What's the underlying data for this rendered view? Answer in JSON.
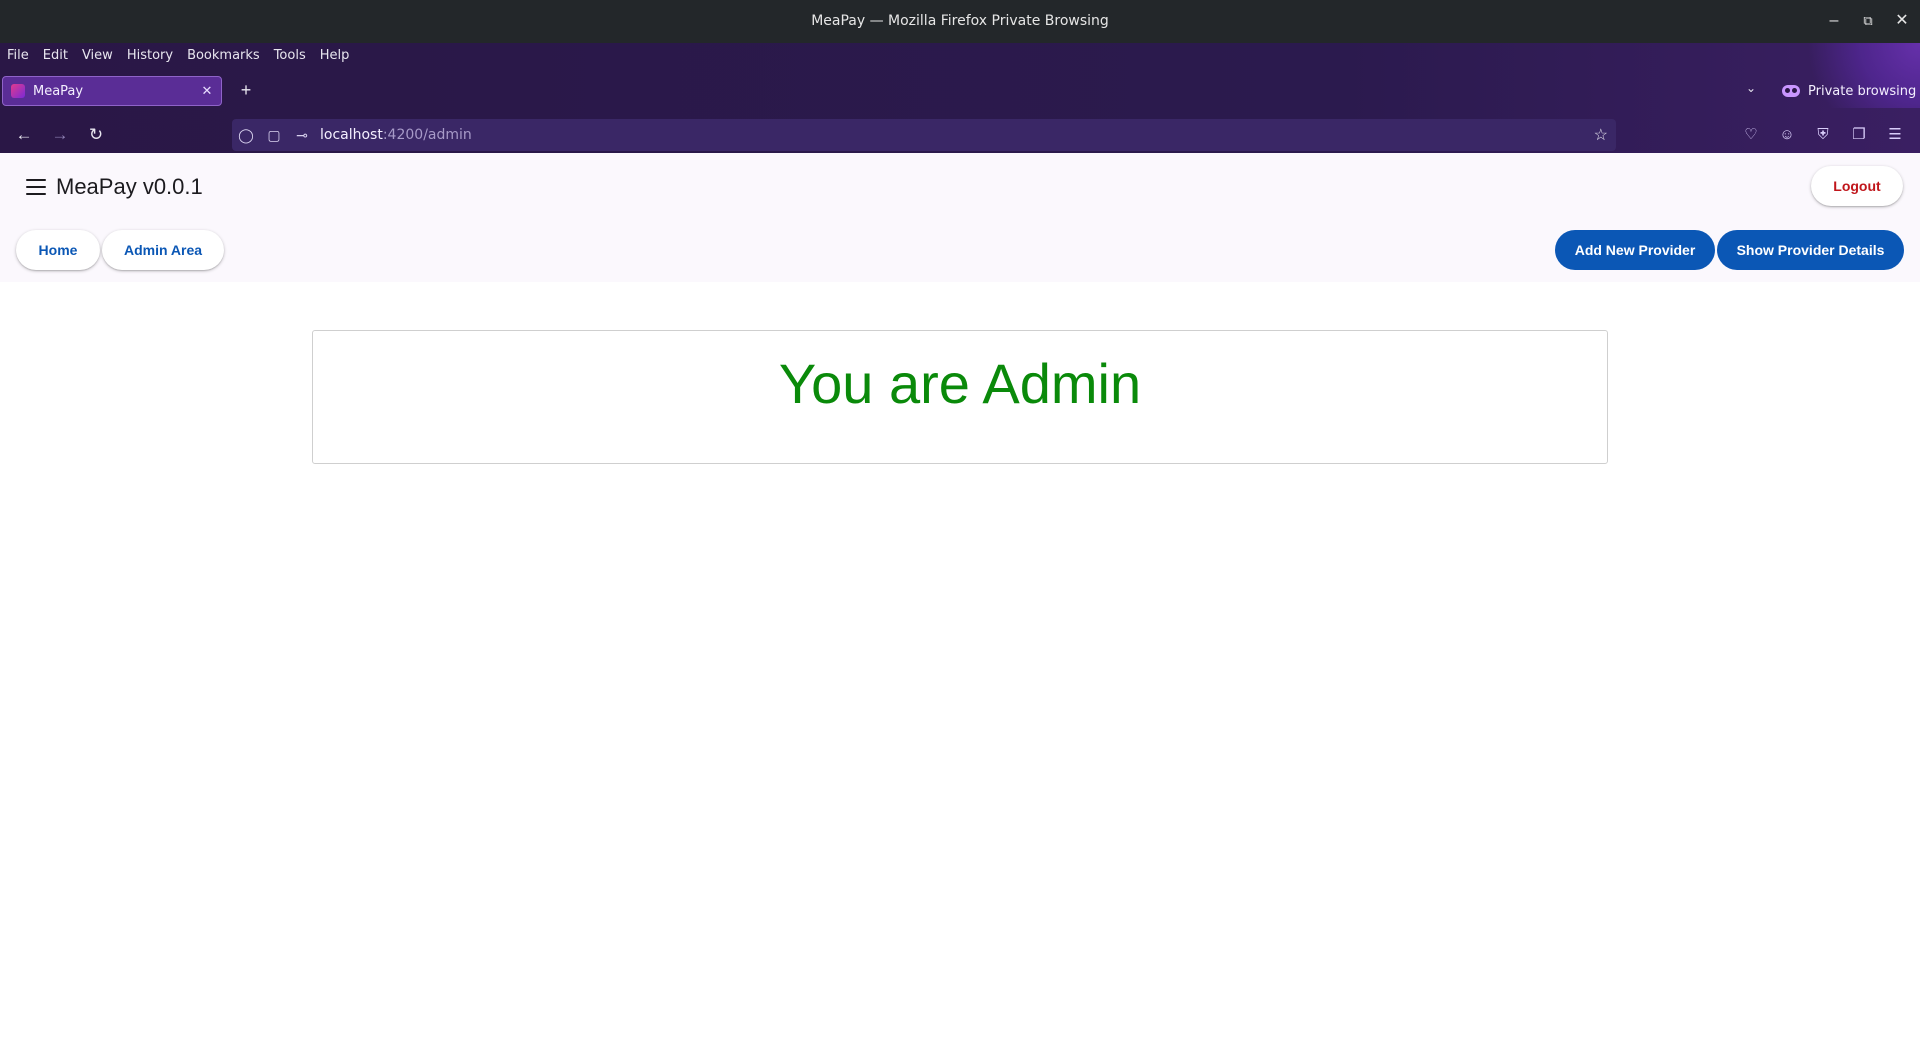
{
  "window": {
    "title": "MeaPay — Mozilla Firefox Private Browsing"
  },
  "browser": {
    "menu": [
      "File",
      "Edit",
      "View",
      "History",
      "Bookmarks",
      "Tools",
      "Help"
    ],
    "tab": {
      "label": "MeaPay"
    },
    "private_label": "Private browsing",
    "url": {
      "host": "localhost",
      "path": ":4200/admin"
    }
  },
  "app": {
    "title": "MeaPay v0.0.1",
    "logout_label": "Logout",
    "nav": {
      "home": "Home",
      "admin": "Admin Area"
    },
    "actions": {
      "add_provider": "Add New Provider",
      "show_provider": "Show Provider Details"
    },
    "message": "You are Admin",
    "colors": {
      "primary": "#0b57b5",
      "logout": "#c0161b",
      "message": "#0a8a0a"
    }
  }
}
